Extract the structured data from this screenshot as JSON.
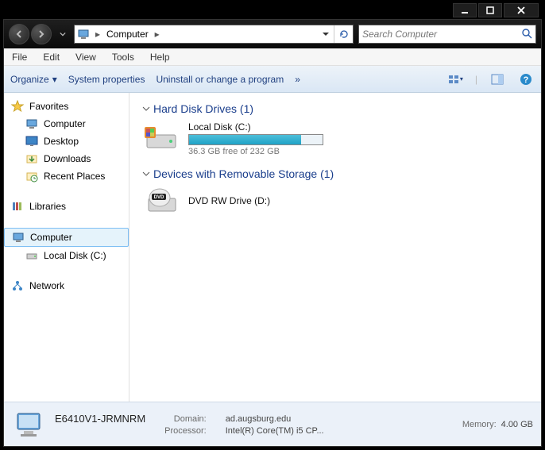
{
  "titlebar": {},
  "address": {
    "crumbs": [
      "Computer"
    ]
  },
  "search": {
    "placeholder": "Search Computer"
  },
  "menubar": {
    "items": [
      "File",
      "Edit",
      "View",
      "Tools",
      "Help"
    ]
  },
  "toolbar": {
    "organize": "Organize",
    "sys_props": "System properties",
    "uninstall": "Uninstall or change a program",
    "overflow": "»"
  },
  "sidebar": {
    "favorites": {
      "label": "Favorites",
      "items": [
        "Computer",
        "Desktop",
        "Downloads",
        "Recent Places"
      ]
    },
    "libraries": {
      "label": "Libraries"
    },
    "computer": {
      "label": "Computer",
      "items": [
        "Local Disk (C:)"
      ]
    },
    "network": {
      "label": "Network"
    }
  },
  "main": {
    "hdd": {
      "title": "Hard Disk Drives (1)",
      "drive": {
        "name": "Local Disk (C:)",
        "sub": "36.3 GB free of 232 GB",
        "fill_pct": 84
      }
    },
    "removable": {
      "title": "Devices with Removable Storage (1)",
      "drive": {
        "name": "DVD RW Drive (D:)"
      }
    }
  },
  "status": {
    "pcname": "E6410V1-JRMNRM",
    "domain_lbl": "Domain:",
    "domain_val": "ad.augsburg.edu",
    "mem_lbl": "Memory:",
    "mem_val": "4.00 GB",
    "proc_lbl": "Processor:",
    "proc_val": "Intel(R) Core(TM) i5 CP..."
  }
}
